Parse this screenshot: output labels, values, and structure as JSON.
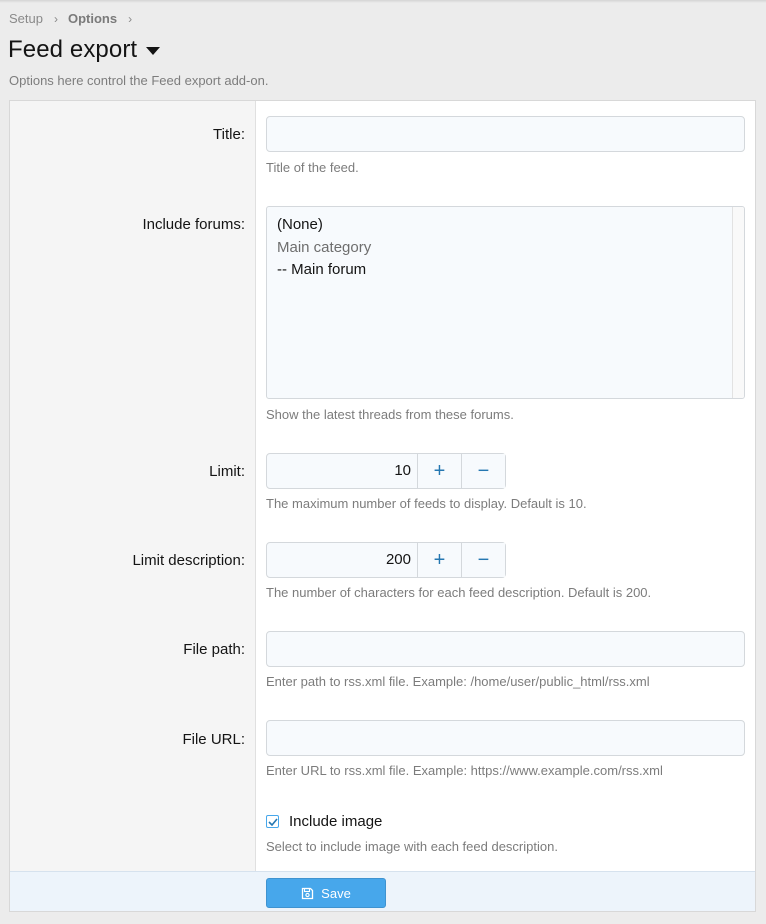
{
  "breadcrumb": {
    "items": [
      "Setup",
      "Options"
    ]
  },
  "page": {
    "title": "Feed export",
    "description": "Options here control the Feed export add-on."
  },
  "form": {
    "title": {
      "label": "Title:",
      "value": "",
      "hint": "Title of the feed."
    },
    "include_forums": {
      "label": "Include forums:",
      "options": [
        "(None)",
        "Main category",
        "-- Main forum"
      ],
      "hint": "Show the latest threads from these forums."
    },
    "limit": {
      "label": "Limit:",
      "value": "10",
      "hint": "The maximum number of feeds to display. Default is 10."
    },
    "limit_description": {
      "label": "Limit description:",
      "value": "200",
      "hint": "The number of characters for each feed description. Default is 200."
    },
    "file_path": {
      "label": "File path:",
      "value": "",
      "hint": "Enter path to rss.xml file. Example: /home/user/public_html/rss.xml"
    },
    "file_url": {
      "label": "File URL:",
      "value": "",
      "hint": "Enter URL to rss.xml file. Example: https://www.example.com/rss.xml"
    },
    "include_image": {
      "label": "Include image",
      "checked": true,
      "hint": "Select to include image with each feed description."
    }
  },
  "stepper": {
    "plus": "+",
    "minus": "−"
  },
  "footer": {
    "save_label": "Save"
  },
  "colors": {
    "accent": "#47a7eb",
    "icon_blue": "#2577b1"
  }
}
